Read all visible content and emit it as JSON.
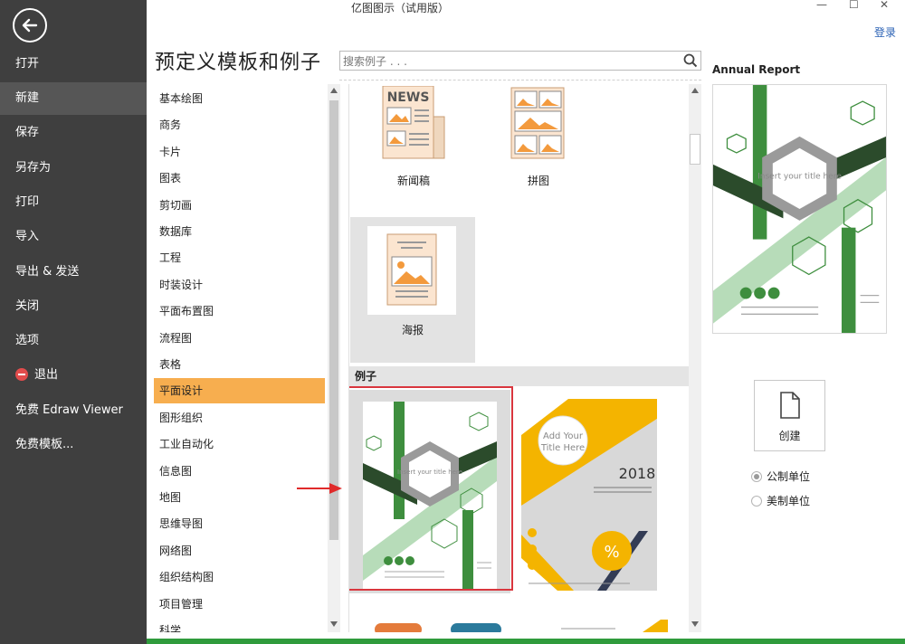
{
  "window": {
    "title": "亿图图示（试用版）",
    "min_glyph": "—",
    "max_glyph": "☐",
    "close_glyph": "✕",
    "login_label": "登录"
  },
  "sidebar": {
    "items": [
      {
        "label": "打开"
      },
      {
        "label": "新建"
      },
      {
        "label": "保存"
      },
      {
        "label": "另存为"
      },
      {
        "label": "打印"
      },
      {
        "label": "导入"
      },
      {
        "label": "导出 & 发送"
      },
      {
        "label": "关闭"
      },
      {
        "label": "选项"
      },
      {
        "label": "退出"
      },
      {
        "label": "免费 Edraw Viewer"
      },
      {
        "label": "免费模板..."
      }
    ],
    "active_index": 1
  },
  "main": {
    "title": "预定义模板和例子",
    "search_placeholder": "搜索例子 . . ."
  },
  "categories": {
    "items": [
      {
        "label": "基本绘图"
      },
      {
        "label": "商务"
      },
      {
        "label": "卡片"
      },
      {
        "label": "图表"
      },
      {
        "label": "剪切画"
      },
      {
        "label": "数据库"
      },
      {
        "label": "工程"
      },
      {
        "label": "时装设计"
      },
      {
        "label": "平面布置图"
      },
      {
        "label": "流程图"
      },
      {
        "label": "表格"
      },
      {
        "label": "平面设计"
      },
      {
        "label": "图形组织"
      },
      {
        "label": "工业自动化"
      },
      {
        "label": "信息图"
      },
      {
        "label": "地图"
      },
      {
        "label": "思维导图"
      },
      {
        "label": "网络图"
      },
      {
        "label": "组织结构图"
      },
      {
        "label": "项目管理"
      },
      {
        "label": "科学"
      }
    ],
    "active_index": 11
  },
  "templates": {
    "items": [
      {
        "label": "新闻稿",
        "thumb_text": "NEWS"
      },
      {
        "label": "拼图"
      },
      {
        "label": "海报"
      }
    ],
    "examples_header": "例子",
    "example1": {
      "thumb_text": "Insert your title here"
    },
    "example2": {
      "thumb_text1": "Add Your",
      "thumb_text2": "Title Here",
      "year": "2018",
      "badge": "%"
    }
  },
  "preview": {
    "title": "Annual Report",
    "thumb_text": "Insert your title here",
    "create_label": "创建",
    "units": [
      {
        "label": "公制单位",
        "checked": true
      },
      {
        "label": "美制单位",
        "checked": false
      }
    ]
  },
  "colors": {
    "sidebar_bg": "#3f3f3f",
    "accent_orange": "#f7ae4f",
    "report_green": "#3e8e3e",
    "highlight_red": "#d9363e"
  },
  "icons": [
    "back-arrow-icon",
    "search-icon",
    "exit-icon",
    "document-icon",
    "red-arrow-icon"
  ]
}
